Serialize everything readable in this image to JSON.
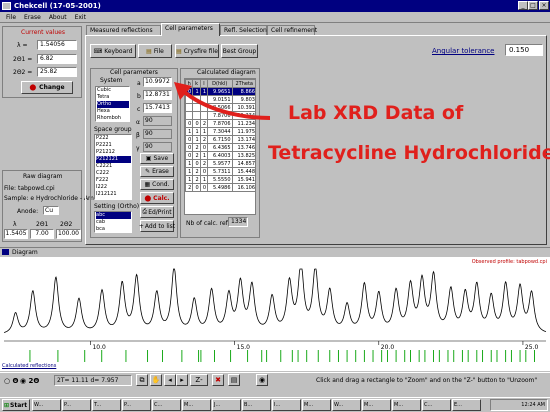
{
  "window": {
    "title": "Chekcell  (17-05-2001)"
  },
  "menu": [
    "File",
    "Erase",
    "About",
    "Exit"
  ],
  "current_values": {
    "heading": "Current values",
    "rows": [
      {
        "label": "λ =",
        "value": "1.54056"
      },
      {
        "label": "2Θ1 =",
        "value": "6.82"
      },
      {
        "label": "2Θ2 =",
        "value": "25.82"
      }
    ],
    "change_label": "Change"
  },
  "raw": {
    "heading": "Raw diagram",
    "file": "File: tabpowd.cpi",
    "sample": "Sample: e Hydrochloride - Ame",
    "anode_label": "Anode:",
    "anode_value": "Cu",
    "cols": [
      "λ",
      "2Θ1",
      "2Θ2"
    ],
    "vals": [
      "1.5405",
      "7.00",
      "100.00"
    ]
  },
  "tabs": [
    "Measured reflections",
    "Cell parameters",
    "Refl. Selection",
    "Cell refinement"
  ],
  "toolbar": {
    "keyboard": "Keyboard",
    "file": "File",
    "crysfire": "Crysfire file",
    "best": "Best Group"
  },
  "angular": {
    "label": "Angular tolerance",
    "value": "0.150"
  },
  "cell_params": {
    "heading": "Cell parameters",
    "system_label": "System",
    "systems": [
      "Cubic",
      "Tetra",
      "Ortho",
      "Hexa",
      "Rhomboh"
    ],
    "selected_system": "Ortho",
    "params": [
      {
        "label": "a",
        "value": "10.9972"
      },
      {
        "label": "b",
        "value": "12.8731"
      },
      {
        "label": "c",
        "value": "15.7413"
      },
      {
        "label": "α",
        "value": "90"
      },
      {
        "label": "β",
        "value": "90"
      },
      {
        "label": "γ",
        "value": "90"
      }
    ],
    "space_group_label": "Space group",
    "space_groups": [
      "P222",
      "P2221",
      "P21212",
      "P212121",
      "C2221",
      "C222",
      "F222",
      "I222",
      "I212121"
    ],
    "selected_space_group": "P212121",
    "setting_label": "Setting (Ortho)",
    "settings": [
      "abc",
      "cab",
      "bca"
    ],
    "selected_setting": "abc",
    "actions": [
      "Save",
      "Erase",
      "Cond.",
      "Calc.",
      "Ed/Print",
      "Add to list"
    ]
  },
  "calc": {
    "heading": "Calculated diagram",
    "cols": [
      "h",
      "k",
      "l",
      "D(hkl)",
      "2Theta"
    ],
    "rows": [
      [
        "0",
        "1",
        "1",
        "9.9651",
        "8.866"
      ],
      [
        "",
        "",
        "",
        "9.0151",
        "9.803"
      ],
      [
        "",
        "",
        "",
        "8.5066",
        "10.391"
      ],
      [
        "",
        "",
        "",
        "7.8706",
        "11.234"
      ],
      [
        "0",
        "0",
        "2",
        "7.8706",
        "11.234"
      ],
      [
        "1",
        "1",
        "1",
        "7.3044",
        "11.975"
      ],
      [
        "0",
        "1",
        "2",
        "6.7150",
        "13.174"
      ],
      [
        "0",
        "2",
        "0",
        "6.4365",
        "13.746"
      ],
      [
        "0",
        "2",
        "1",
        "6.4003",
        "13.825"
      ],
      [
        "1",
        "0",
        "2",
        "5.9577",
        "14.857"
      ],
      [
        "1",
        "2",
        "0",
        "5.7311",
        "15.448"
      ],
      [
        "1",
        "2",
        "1",
        "5.5550",
        "15.941"
      ],
      [
        "2",
        "0",
        "0",
        "5.4986",
        "16.106"
      ]
    ],
    "selected_row": 0,
    "nb_label": "Nb of calc. refl.",
    "nb_value": "1334"
  },
  "annotation": {
    "line1": "Lab XRD Data of",
    "line2": "Tetracycline Hydrochloride",
    "color": "#e0201c"
  },
  "diagram": {
    "title": "Diagram",
    "observed_label": "Observed profile: tabpowd.cpi",
    "ticks": [
      "10.0",
      "15.0",
      "20.0",
      "25.0"
    ],
    "calc_refl_label": "Calculated reflections"
  },
  "chart_data": {
    "type": "line",
    "title": "",
    "xlabel": "",
    "ylabel": "",
    "xlim": [
      7.0,
      25.8
    ],
    "x_ticks": [
      10.0,
      15.0,
      20.0,
      25.0
    ],
    "series": [
      {
        "name": "Observed profile: tabpowd.cpi",
        "peaks": [
          {
            "x": 7.4,
            "h": 0.3
          },
          {
            "x": 8.0,
            "h": 0.62
          },
          {
            "x": 8.8,
            "h": 0.82
          },
          {
            "x": 9.6,
            "h": 0.5
          },
          {
            "x": 10.4,
            "h": 0.62
          },
          {
            "x": 11.1,
            "h": 0.72
          },
          {
            "x": 11.6,
            "h": 0.82
          },
          {
            "x": 12.3,
            "h": 0.58
          },
          {
            "x": 12.9,
            "h": 0.95
          },
          {
            "x": 13.6,
            "h": 0.48
          },
          {
            "x": 14.2,
            "h": 0.62
          },
          {
            "x": 14.8,
            "h": 0.55
          },
          {
            "x": 15.2,
            "h": 0.72
          },
          {
            "x": 15.6,
            "h": 0.68
          },
          {
            "x": 16.3,
            "h": 0.52
          },
          {
            "x": 16.9,
            "h": 0.72
          },
          {
            "x": 17.3,
            "h": 0.98
          },
          {
            "x": 17.8,
            "h": 0.92
          },
          {
            "x": 18.3,
            "h": 0.6
          },
          {
            "x": 18.9,
            "h": 0.4
          },
          {
            "x": 19.5,
            "h": 0.7
          },
          {
            "x": 20.0,
            "h": 0.56
          },
          {
            "x": 20.6,
            "h": 0.6
          },
          {
            "x": 21.1,
            "h": 0.68
          },
          {
            "x": 21.5,
            "h": 0.74
          },
          {
            "x": 21.9,
            "h": 0.82
          },
          {
            "x": 22.5,
            "h": 0.62
          },
          {
            "x": 23.0,
            "h": 0.56
          },
          {
            "x": 23.4,
            "h": 0.68
          },
          {
            "x": 23.9,
            "h": 0.52
          },
          {
            "x": 24.4,
            "h": 0.7
          },
          {
            "x": 24.9,
            "h": 0.66
          },
          {
            "x": 25.3,
            "h": 0.58
          }
        ]
      }
    ],
    "calculated_reflections": [
      7.9,
      8.87,
      9.8,
      10.39,
      11.23,
      11.98,
      12.5,
      13.17,
      13.75,
      13.83,
      14.3,
      14.86,
      15.45,
      15.94,
      16.11,
      16.6,
      17.0,
      17.2,
      17.5,
      17.9,
      18.3,
      18.6,
      18.9,
      19.2,
      19.5,
      19.8,
      20.1,
      20.3,
      20.6,
      20.9,
      21.1,
      21.4,
      21.6,
      21.9,
      22.1,
      22.4,
      22.6,
      22.9,
      23.1,
      23.4,
      23.6,
      23.9,
      24.1,
      24.4,
      24.6,
      24.9,
      25.1,
      25.4
    ]
  },
  "status": {
    "theta_label": "Θ",
    "twotheta_label": "2Θ",
    "readout": "2T= 11.11  d= 7.957",
    "hint": "Click and drag a rectangle to \"Zoom\" and on the \"Z-\" button to \"Unzoom\""
  },
  "taskbar": {
    "start": "Start",
    "items": [
      "W...",
      "P...",
      "T...",
      "P...",
      "C...",
      "M...",
      "J...",
      "B...",
      "I...",
      "M...",
      "W...",
      "M...",
      "M...",
      "C...",
      "E..."
    ],
    "clock": "12:24 AM"
  }
}
